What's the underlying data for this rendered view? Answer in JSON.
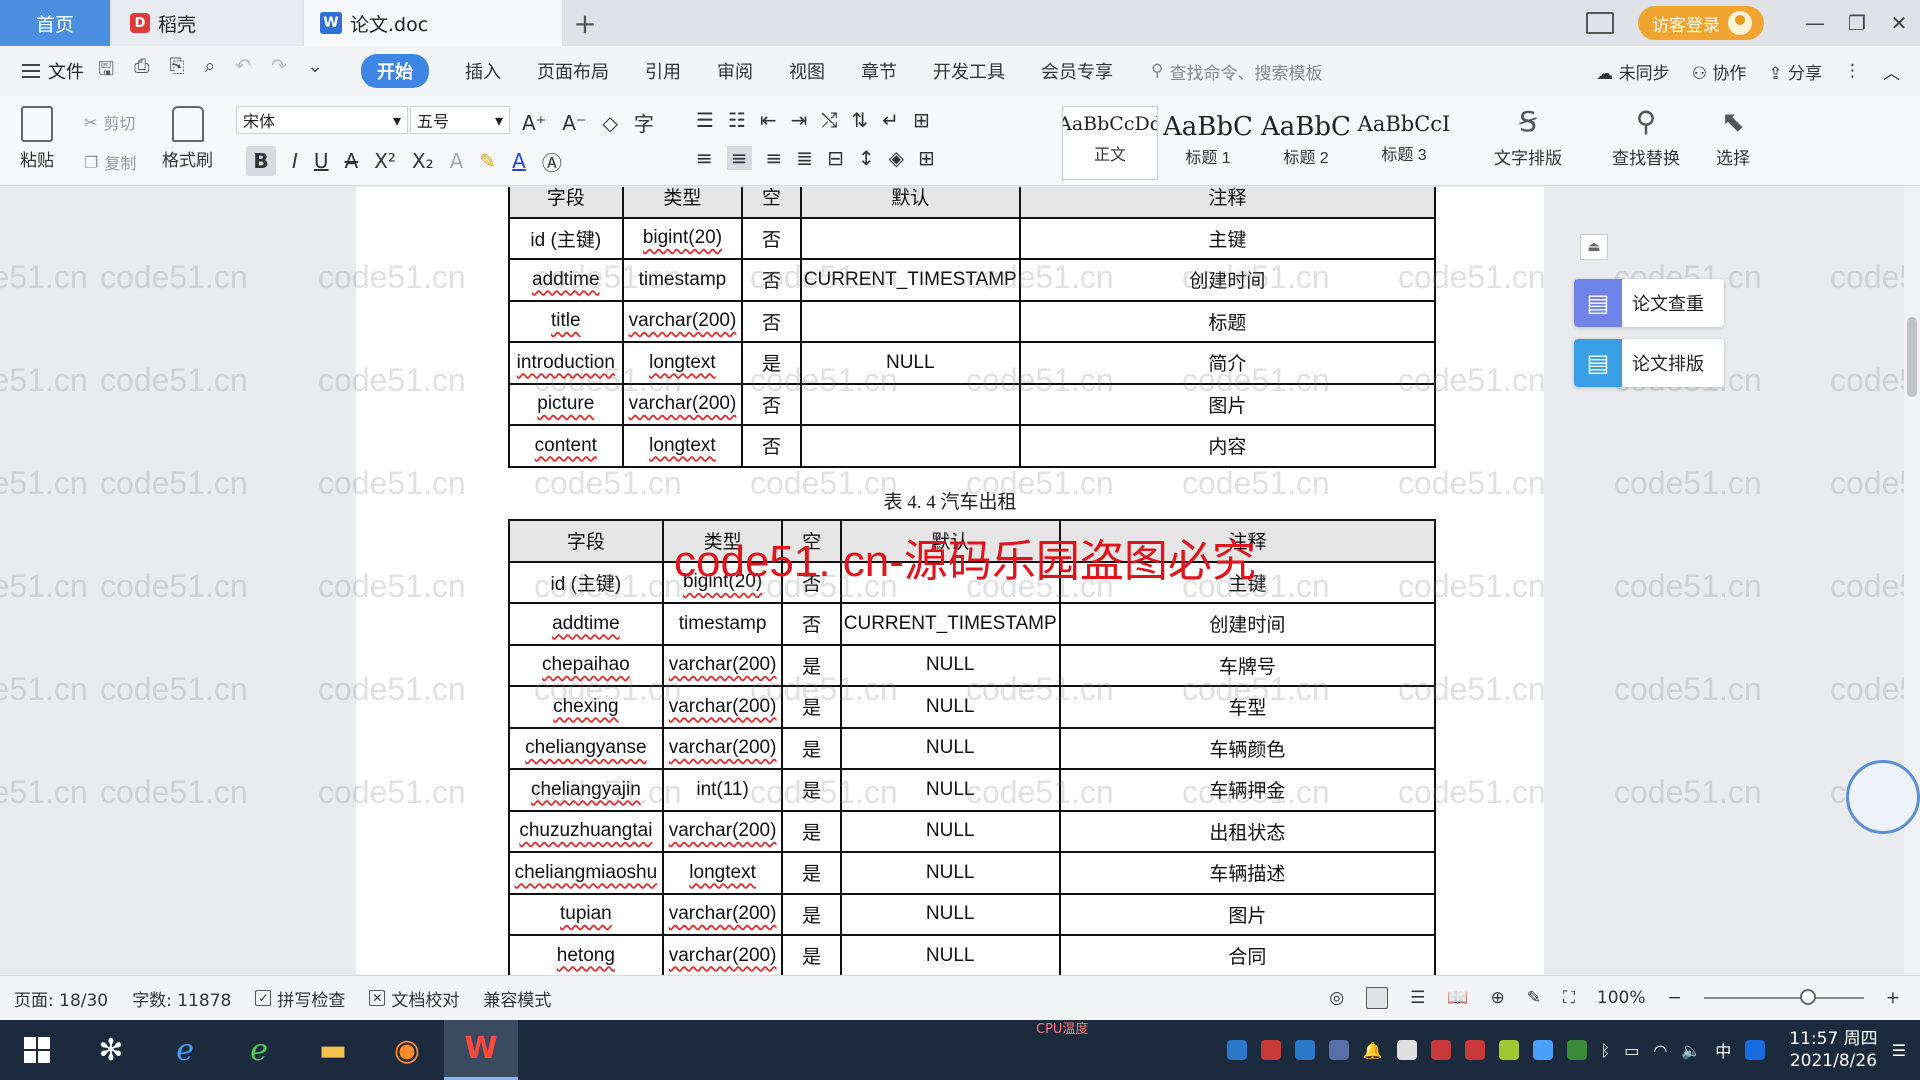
{
  "tabs": {
    "home": "首页",
    "daoke": "稻壳",
    "doc": "论文.doc",
    "add": "+"
  },
  "titlebar": {
    "guest_login": "访客登录",
    "minimize": "—",
    "restore": "❐",
    "close": "✕"
  },
  "menu": {
    "file": "文件",
    "items": [
      "开始",
      "插入",
      "页面布局",
      "引用",
      "审阅",
      "视图",
      "章节",
      "开发工具",
      "会员专享"
    ],
    "active_index": 0,
    "search_placeholder": "查找命令、搜索模板",
    "right": [
      "未同步",
      "协作",
      "分享"
    ]
  },
  "ribbon": {
    "paste": "粘贴",
    "cut": "剪切",
    "copy": "复制",
    "format_painter": "格式刷",
    "font_name": "宋体",
    "font_size": "五号",
    "styles": [
      {
        "sample": "AaBbCcDd",
        "label": "正文"
      },
      {
        "sample": "AaBbC",
        "label": "标题 1"
      },
      {
        "sample": "AaBbC",
        "label": "标题 2"
      },
      {
        "sample": "AaBbCcI",
        "label": "标题 3"
      }
    ],
    "text_layout": "文字排版",
    "find_replace": "查找替换",
    "select": "选择"
  },
  "side_panel": {
    "check": "论文查重",
    "layout": "论文排版"
  },
  "document": {
    "table1": {
      "headers": [
        "字段",
        "类型",
        "空",
        "默认",
        "注释"
      ],
      "rows": [
        [
          "id (主键)",
          "bigint(20)",
          "否",
          "",
          "主键"
        ],
        [
          "addtime",
          "timestamp",
          "否",
          "CURRENT_TIMESTAMP",
          "创建时间"
        ],
        [
          "title",
          "varchar(200)",
          "否",
          "",
          "标题"
        ],
        [
          "introduction",
          "longtext",
          "是",
          "NULL",
          "简介"
        ],
        [
          "picture",
          "varchar(200)",
          "否",
          "",
          "图片"
        ],
        [
          "content",
          "longtext",
          "否",
          "",
          "内容"
        ]
      ]
    },
    "caption2": "表 4. 4 汽车出租",
    "table2": {
      "headers": [
        "字段",
        "类型",
        "空",
        "默认",
        "注释"
      ],
      "rows": [
        [
          "id (主键)",
          "bigint(20)",
          "否",
          "",
          "主键"
        ],
        [
          "addtime",
          "timestamp",
          "否",
          "CURRENT_TIMESTAMP",
          "创建时间"
        ],
        [
          "chepaihao",
          "varchar(200)",
          "是",
          "NULL",
          "车牌号"
        ],
        [
          "chexing",
          "varchar(200)",
          "是",
          "NULL",
          "车型"
        ],
        [
          "cheliangyanse",
          "varchar(200)",
          "是",
          "NULL",
          "车辆颜色"
        ],
        [
          "cheliangyajin",
          "int(11)",
          "是",
          "NULL",
          "车辆押金"
        ],
        [
          "chuzuzhuangtai",
          "varchar(200)",
          "是",
          "NULL",
          "出租状态"
        ],
        [
          "cheliangmiaoshu",
          "longtext",
          "是",
          "NULL",
          "车辆描述"
        ],
        [
          "tupian",
          "varchar(200)",
          "是",
          "NULL",
          "图片"
        ],
        [
          "hetong",
          "varchar(200)",
          "是",
          "NULL",
          "合同"
        ]
      ]
    },
    "watermark": "code51.cn",
    "stamp": "code51. cn-源码乐园盗图必究"
  },
  "statusbar": {
    "page": "页面: 18/30",
    "words": "字数: 11878",
    "spell": "拼写检查",
    "proof": "文档校对",
    "compat": "兼容模式",
    "zoom": "100%",
    "zoom_level": 1.0
  },
  "taskbar": {
    "time": "11:57 周四",
    "date": "2021/8/26",
    "cpu_label": "CPU温度",
    "ime": "中"
  },
  "colors": {
    "accent": "#3d86e6",
    "guest": "#f0a530",
    "stamp": "#e0141c",
    "taskbar": "#1c2a3d"
  }
}
